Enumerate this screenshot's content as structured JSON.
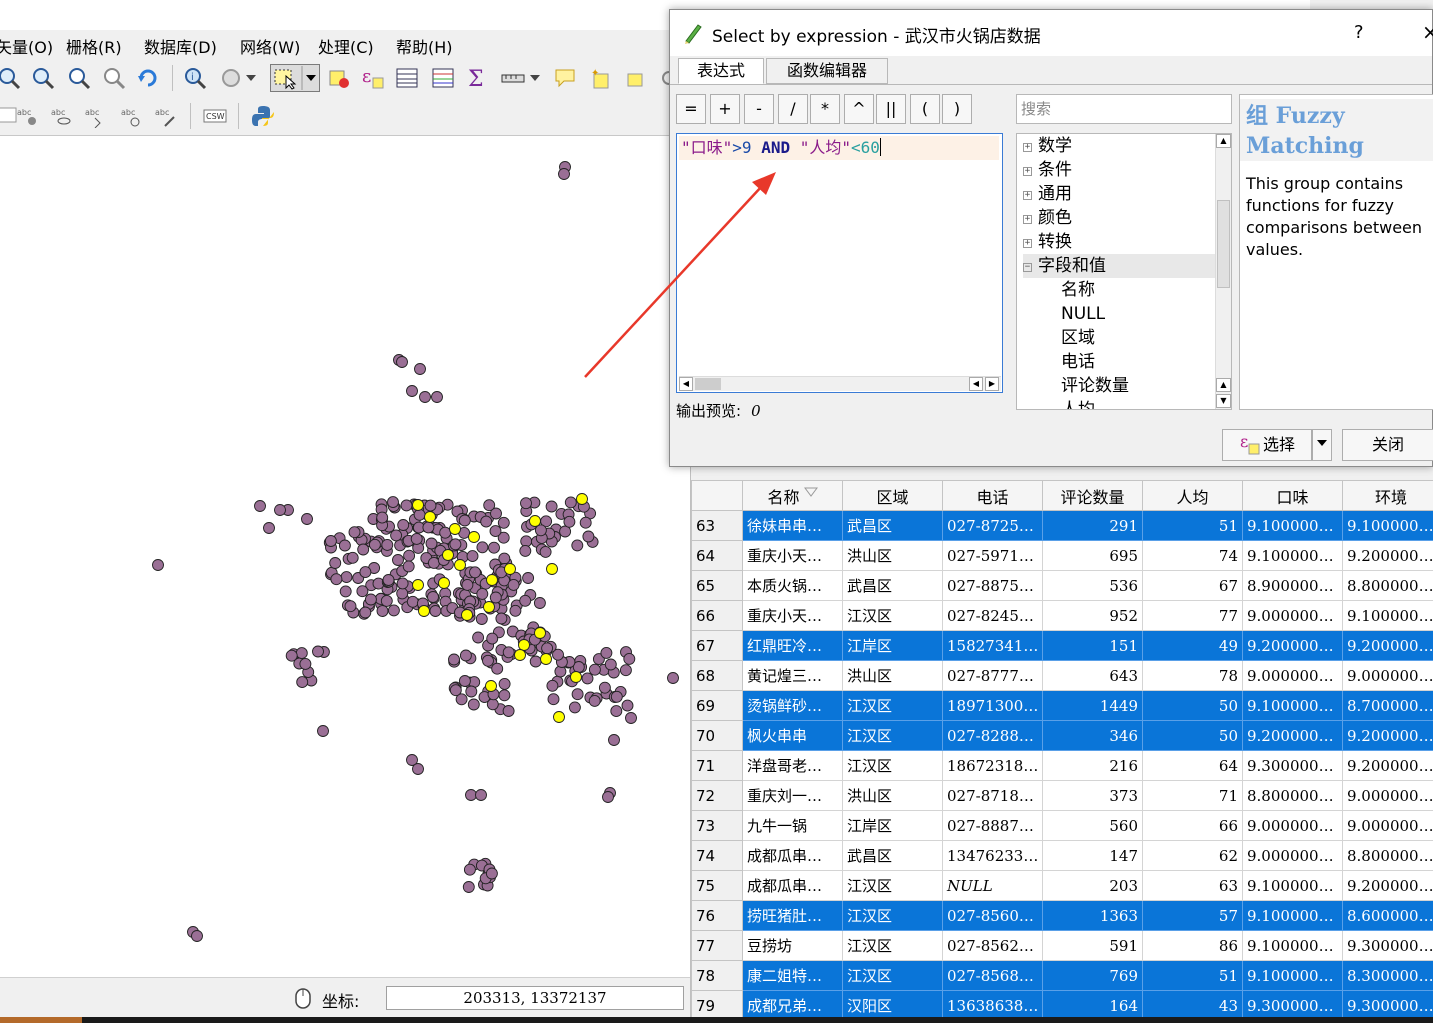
{
  "menubar": {
    "items": [
      "矢量(O)",
      "栅格(R)",
      "数据库(D)",
      "网络(W)",
      "处理(C)",
      "帮助(H)"
    ]
  },
  "statusbar": {
    "coord_label": "坐标:",
    "coord_value": "203313, 13372137"
  },
  "dialog": {
    "title": "Select by expression - 武汉市火锅店数据",
    "help_label": "?",
    "close_x": "×",
    "tabs": [
      "表达式",
      "函数编辑器"
    ],
    "operators": [
      "=",
      "+",
      "-",
      "/",
      "*",
      "^",
      "||",
      "(",
      ")"
    ],
    "expression": {
      "field1": "\"口味\"",
      "op1": ">9",
      "and": "AND",
      "field2": "\"人均\"",
      "op2": "<60"
    },
    "output_preview_label": "输出预览:",
    "output_preview_value": "0",
    "search_placeholder": "搜索",
    "tree": {
      "groups": [
        "数学",
        "条件",
        "通用",
        "颜色",
        "转换",
        "字段和值"
      ],
      "children": [
        "名称",
        "NULL",
        "区域",
        "电话",
        "评论数量",
        "人均"
      ]
    },
    "help": {
      "title": "组 Fuzzy Matching",
      "body": "This group contains functions for fuzzy comparisons between values."
    },
    "select_button": "选择",
    "close_button": "关闭"
  },
  "attribute_table": {
    "columns": [
      "名称",
      "区域",
      "电话",
      "评论数量",
      "人均",
      "口味",
      "环境"
    ],
    "rows": [
      {
        "n": "63",
        "name": "徐妹串串…",
        "district": "武昌区",
        "phone": "027-8725…",
        "reviews": "291",
        "avg": "51",
        "taste": "9.100000…",
        "env": "9.100000…",
        "selected": true
      },
      {
        "n": "64",
        "name": "重庆小天…",
        "district": "洪山区",
        "phone": "027-5971…",
        "reviews": "695",
        "avg": "74",
        "taste": "9.100000…",
        "env": "9.200000…",
        "selected": false
      },
      {
        "n": "65",
        "name": "本质火锅…",
        "district": "武昌区",
        "phone": "027-8875…",
        "reviews": "536",
        "avg": "67",
        "taste": "8.900000…",
        "env": "8.800000…",
        "selected": false
      },
      {
        "n": "66",
        "name": "重庆小天…",
        "district": "江汉区",
        "phone": "027-8245…",
        "reviews": "952",
        "avg": "77",
        "taste": "9.000000…",
        "env": "9.100000…",
        "selected": false
      },
      {
        "n": "67",
        "name": "红鼎旺冷…",
        "district": "江岸区",
        "phone": "15827341…",
        "reviews": "151",
        "avg": "49",
        "taste": "9.200000…",
        "env": "9.200000…",
        "selected": true
      },
      {
        "n": "68",
        "name": "黄记煌三…",
        "district": "洪山区",
        "phone": "027-8777…",
        "reviews": "643",
        "avg": "78",
        "taste": "9.000000…",
        "env": "9.000000…",
        "selected": false
      },
      {
        "n": "69",
        "name": "烫锅鲜砂…",
        "district": "江汉区",
        "phone": "18971300…",
        "reviews": "1449",
        "avg": "50",
        "taste": "9.100000…",
        "env": "8.700000…",
        "selected": true
      },
      {
        "n": "70",
        "name": "枫火串串",
        "district": "江汉区",
        "phone": "027-8288…",
        "reviews": "346",
        "avg": "50",
        "taste": "9.200000…",
        "env": "9.200000…",
        "selected": true
      },
      {
        "n": "71",
        "name": "洋盘哥老…",
        "district": "江汉区",
        "phone": "18672318…",
        "reviews": "216",
        "avg": "64",
        "taste": "9.300000…",
        "env": "9.200000…",
        "selected": false
      },
      {
        "n": "72",
        "name": "重庆刘一…",
        "district": "洪山区",
        "phone": "027-8718…",
        "reviews": "373",
        "avg": "71",
        "taste": "8.800000…",
        "env": "9.000000…",
        "selected": false
      },
      {
        "n": "73",
        "name": "九牛一锅",
        "district": "江岸区",
        "phone": "027-8887…",
        "reviews": "560",
        "avg": "66",
        "taste": "9.000000…",
        "env": "9.000000…",
        "selected": false
      },
      {
        "n": "74",
        "name": "成都瓜串…",
        "district": "武昌区",
        "phone": "13476233…",
        "reviews": "147",
        "avg": "62",
        "taste": "9.000000…",
        "env": "8.800000…",
        "selected": false
      },
      {
        "n": "75",
        "name": "成都瓜串…",
        "district": "江汉区",
        "phone": "NULL",
        "reviews": "203",
        "avg": "63",
        "taste": "9.100000…",
        "env": "9.200000…",
        "selected": false
      },
      {
        "n": "76",
        "name": "捞旺猪肚…",
        "district": "江汉区",
        "phone": "027-8560…",
        "reviews": "1363",
        "avg": "57",
        "taste": "9.100000…",
        "env": "8.600000…",
        "selected": true
      },
      {
        "n": "77",
        "name": "豆捞坊",
        "district": "江汉区",
        "phone": "027-8562…",
        "reviews": "591",
        "avg": "86",
        "taste": "9.100000…",
        "env": "9.300000…",
        "selected": false
      },
      {
        "n": "78",
        "name": "康二姐特…",
        "district": "江汉区",
        "phone": "027-8568…",
        "reviews": "769",
        "avg": "51",
        "taste": "9.100000…",
        "env": "8.300000…",
        "selected": true
      },
      {
        "n": "79",
        "name": "成都兄弟…",
        "district": "汉阳区",
        "phone": "13638638…",
        "reviews": "164",
        "avg": "43",
        "taste": "9.300000…",
        "env": "9.300000…",
        "selected": true
      }
    ]
  },
  "colors": {
    "point_fill": "#9a6f95",
    "point_selected_fill": "#ffff00",
    "row_selected": "#0a75d8",
    "help_title": "#6a9fd8"
  }
}
